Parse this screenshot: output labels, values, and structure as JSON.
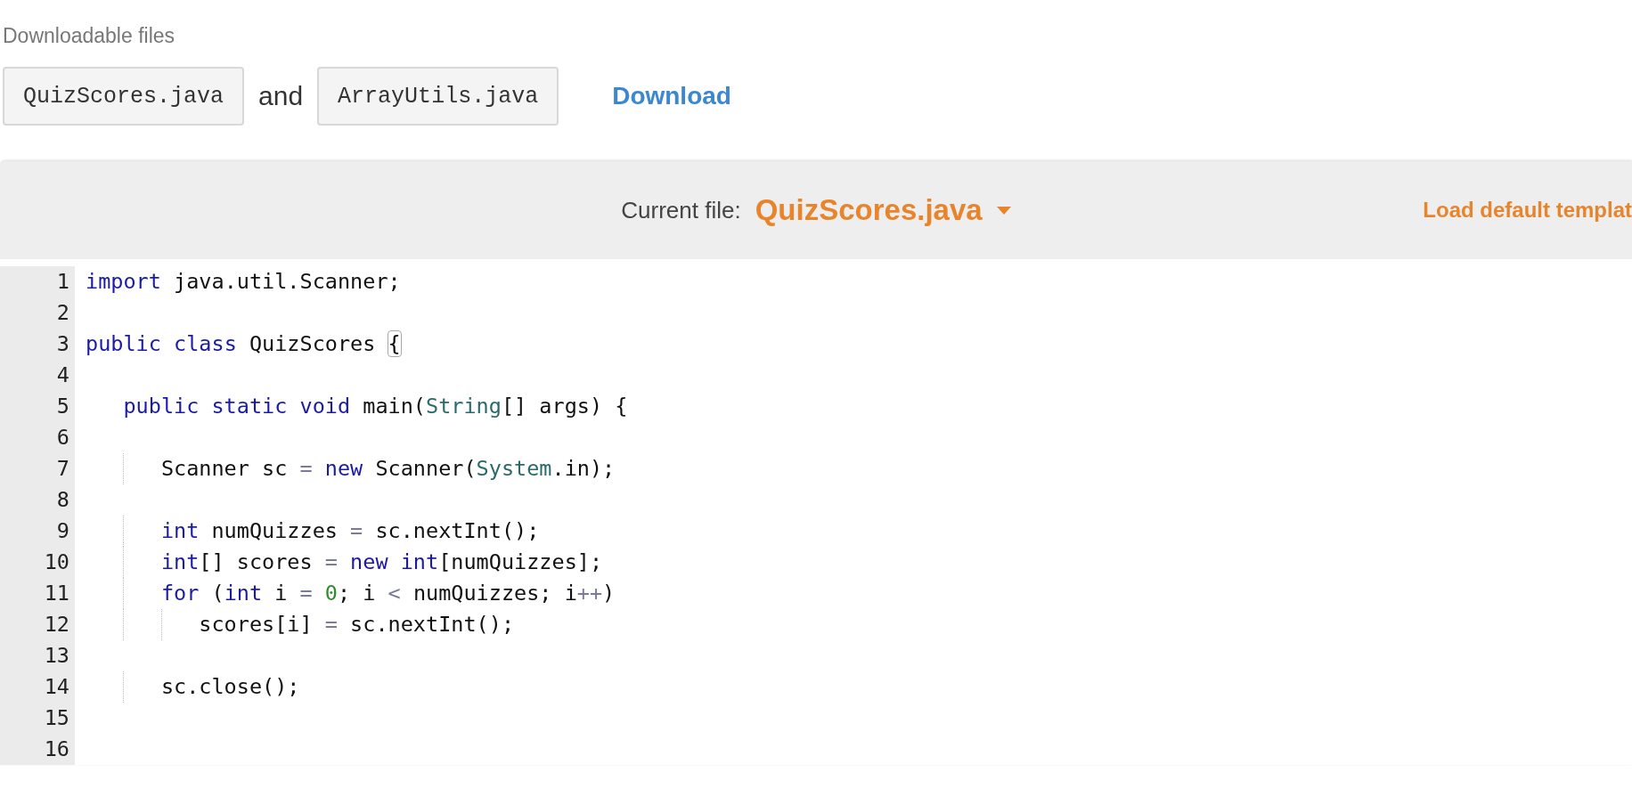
{
  "downloads": {
    "label": "Downloadable files",
    "files": [
      "QuizScores.java",
      "ArrayUtils.java"
    ],
    "joiner": "and",
    "action": "Download"
  },
  "editor": {
    "current_file_label": "Current file:",
    "current_file": "QuizScores.java",
    "load_template": "Load default templat",
    "lines": [
      {
        "number": "1",
        "tokens": [
          {
            "kind": "keyword",
            "text": "import"
          },
          {
            "kind": "plain",
            "text": " java.util.Scanner;"
          }
        ]
      },
      {
        "number": "2"
      },
      {
        "number": "3",
        "tokens": [
          {
            "kind": "keyword",
            "text": "public class"
          },
          {
            "kind": "plain",
            "text": " QuizScores "
          },
          {
            "kind": "bracket-match",
            "text": "{"
          }
        ],
        "children": [
          {
            "number": "4"
          },
          {
            "number": "5",
            "tokens": [
              {
                "kind": "keyword",
                "text": "public static void"
              },
              {
                "kind": "plain",
                "text": " main("
              },
              {
                "kind": "type",
                "text": "String"
              },
              {
                "kind": "plain",
                "text": "[] args) {"
              }
            ],
            "children": [
              {
                "number": "6"
              },
              {
                "number": "7",
                "tokens": [
                  {
                    "kind": "plain",
                    "text": "Scanner sc "
                  },
                  {
                    "kind": "operator",
                    "text": "= "
                  },
                  {
                    "kind": "keyword",
                    "text": "new"
                  },
                  {
                    "kind": "plain",
                    "text": " Scanner("
                  },
                  {
                    "kind": "type",
                    "text": "System"
                  },
                  {
                    "kind": "plain",
                    "text": ".in);"
                  }
                ]
              },
              {
                "number": "8"
              },
              {
                "number": "9",
                "tokens": [
                  {
                    "kind": "keyword",
                    "text": "int"
                  },
                  {
                    "kind": "plain",
                    "text": " numQuizzes "
                  },
                  {
                    "kind": "operator",
                    "text": "="
                  },
                  {
                    "kind": "plain",
                    "text": " sc.nextInt();"
                  }
                ]
              },
              {
                "number": "10",
                "tokens": [
                  {
                    "kind": "keyword",
                    "text": "int"
                  },
                  {
                    "kind": "plain",
                    "text": "[] scores "
                  },
                  {
                    "kind": "operator",
                    "text": "= "
                  },
                  {
                    "kind": "keyword",
                    "text": "new int"
                  },
                  {
                    "kind": "plain",
                    "text": "[numQuizzes];"
                  }
                ]
              },
              {
                "number": "11",
                "tokens": [
                  {
                    "kind": "keyword",
                    "text": "for"
                  },
                  {
                    "kind": "plain",
                    "text": " ("
                  },
                  {
                    "kind": "keyword",
                    "text": "int"
                  },
                  {
                    "kind": "plain",
                    "text": " i "
                  },
                  {
                    "kind": "operator",
                    "text": "= "
                  },
                  {
                    "kind": "number",
                    "text": "0"
                  },
                  {
                    "kind": "plain",
                    "text": "; i "
                  },
                  {
                    "kind": "operator",
                    "text": "<"
                  },
                  {
                    "kind": "plain",
                    "text": " numQuizzes; i"
                  },
                  {
                    "kind": "operator",
                    "text": "++"
                  },
                  {
                    "kind": "plain",
                    "text": ")"
                  }
                ],
                "children": [
                  {
                    "number": "12",
                    "tokens": [
                      {
                        "kind": "plain",
                        "text": "scores[i] "
                      },
                      {
                        "kind": "operator",
                        "text": "="
                      },
                      {
                        "kind": "plain",
                        "text": " sc.nextInt();"
                      }
                    ]
                  }
                ]
              },
              {
                "number": "13"
              },
              {
                "number": "14",
                "tokens": [
                  {
                    "kind": "plain",
                    "text": "sc.close();"
                  }
                ]
              },
              {
                "number": "15"
              },
              {
                "number": "16"
              }
            ]
          }
        ]
      }
    ]
  }
}
